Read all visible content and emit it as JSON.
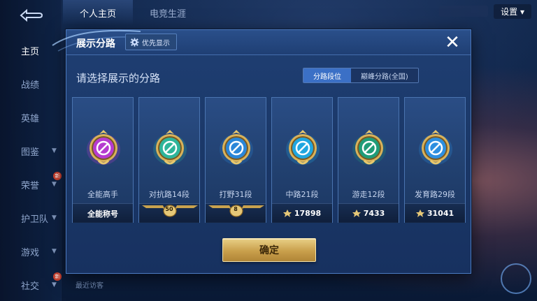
{
  "nav": {
    "items": [
      {
        "label": "主页",
        "active": true
      },
      {
        "label": "战绩"
      },
      {
        "label": "英雄"
      },
      {
        "label": "图鉴"
      },
      {
        "label": "荣誉",
        "hot": "新"
      },
      {
        "label": "护卫队"
      },
      {
        "label": "游戏"
      },
      {
        "label": "社交",
        "hot": "新"
      }
    ]
  },
  "top_tabs": [
    "个人主页",
    "电竞生涯"
  ],
  "settings_label": "设置",
  "visitor_label": "最近访客",
  "modal": {
    "title": "展示分路",
    "priority_label": "优先显示",
    "close_glyph": "✕",
    "subtitle": "请选择展示的分路",
    "segments": [
      {
        "label": "分路段位",
        "active": true
      },
      {
        "label": "巅峰分路(全国)",
        "active": false
      }
    ],
    "cards": [
      {
        "name": "全能高手",
        "footer_type": "text",
        "footer": "全能称号",
        "emblem": "allround-emblem-icon",
        "color": "#b63bd0"
      },
      {
        "name": "对抗路14段",
        "footer_type": "badge",
        "badge": "50",
        "emblem": "clash-lane-emblem-icon",
        "color": "#2eb59a"
      },
      {
        "name": "打野31段",
        "footer_type": "badge",
        "badge": "8",
        "emblem": "jungle-emblem-icon",
        "color": "#2a86d8"
      },
      {
        "name": "中路21段",
        "footer_type": "score",
        "score": "17898",
        "emblem": "mid-lane-emblem-icon",
        "color": "#1fa6e0"
      },
      {
        "name": "游走12段",
        "footer_type": "score",
        "score": "7433",
        "emblem": "roam-emblem-icon",
        "color": "#1f9c78"
      },
      {
        "name": "发育路29段",
        "footer_type": "score",
        "score": "31041",
        "emblem": "farm-lane-emblem-icon",
        "color": "#2d8fe0"
      }
    ],
    "confirm_label": "确定"
  },
  "colors": {
    "modal_bg": "#1f3f73",
    "accent_blue": "#3b70c6",
    "gold": "#c99f4b"
  }
}
